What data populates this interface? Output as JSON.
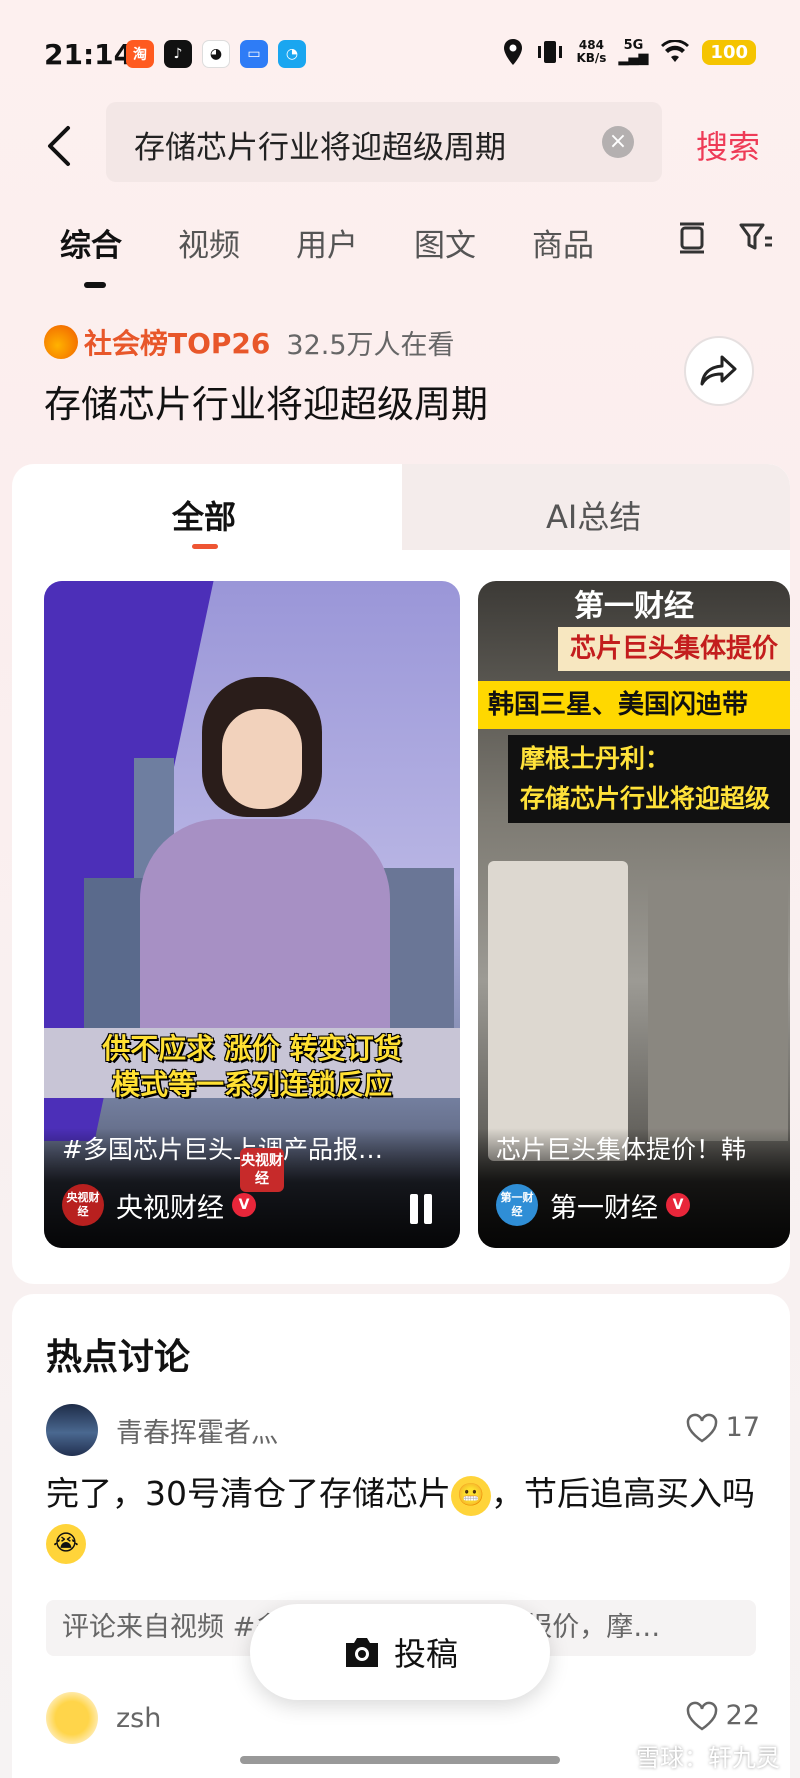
{
  "status_bar": {
    "time": "21:14",
    "net_speed_value": "484",
    "net_speed_unit": "KB/s",
    "signal": "5G",
    "battery": "100"
  },
  "search": {
    "query": "存储芯片行业将迎超级周期",
    "button_label": "搜索"
  },
  "tabs": [
    {
      "label": "综合",
      "active": true
    },
    {
      "label": "视频"
    },
    {
      "label": "用户"
    },
    {
      "label": "图文"
    },
    {
      "label": "商品"
    }
  ],
  "hot": {
    "rank": "社会榜TOP26",
    "viewers": "32.5万人在看",
    "headline": "存储芯片行业将迎超级周期"
  },
  "panel_tabs": {
    "all": "全部",
    "ai_summary": "AI总结"
  },
  "videos": [
    {
      "caption_line1": "供不应求 涨价 转变订货",
      "caption_line2": "模式等一系列连锁反应",
      "title": "#多国芯片巨头上调产品报…",
      "author": "央视财经",
      "author_logo": "央视财经",
      "verified": "V",
      "badge": "央视财经"
    },
    {
      "brand": "第一财经",
      "headline1": "芯片巨头集体提价",
      "headline2": "韩国三星、美国闪迪带",
      "quote1": "摩根士丹利：",
      "quote2": "存储芯片行业将迎超级",
      "title": "芯片巨头集体提价！韩",
      "author": "第一财经",
      "author_logo": "第一财经",
      "verified": "V"
    }
  ],
  "discussion": {
    "title": "热点讨论",
    "comments": [
      {
        "user": "青春挥霍者灬",
        "likes": "17",
        "text_part1": "完了，30号清仓了存储芯片",
        "text_part2": "，节后追高买入吗",
        "source": "评论来自视频 #多国芯片巨头上调产品报价，摩…"
      },
      {
        "user": "zsh",
        "likes": "22"
      }
    ]
  },
  "post_button": "投稿",
  "watermark": "雪球：轩九灵",
  "colors": {
    "accent": "#ee3b57",
    "rank": "#e8572a",
    "verified": "#e8263a"
  }
}
